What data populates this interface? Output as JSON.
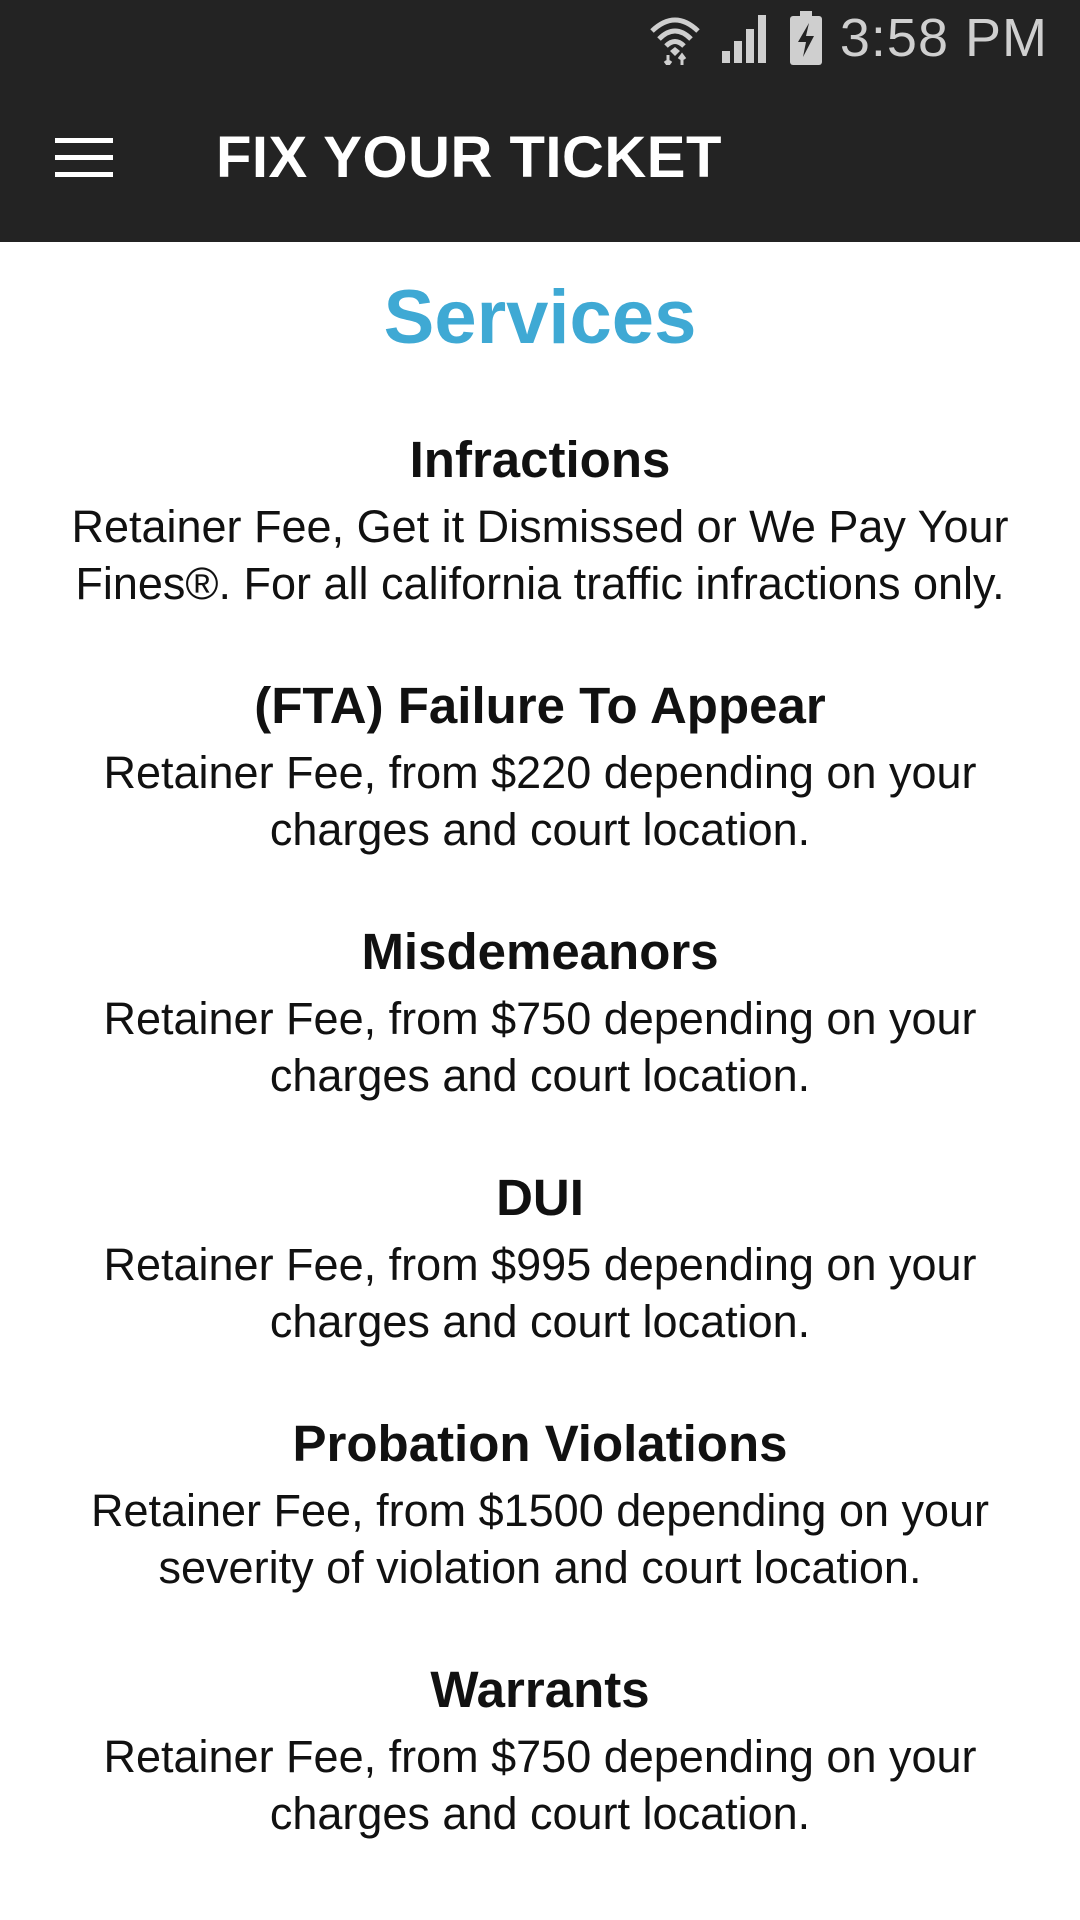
{
  "status_bar": {
    "time": "3:58 PM",
    "icons": [
      "wifi-icon",
      "signal-icon",
      "battery-charging-icon"
    ]
  },
  "app_bar": {
    "title": "FIX YOUR TICKET",
    "menu_icon": "hamburger-menu-icon"
  },
  "main": {
    "heading": "Services",
    "heading_color": "#3fa9d4",
    "services": [
      {
        "title": "Infractions",
        "description": "Retainer Fee, Get it Dismissed or We Pay Your Fines®. For all california traffic infractions only."
      },
      {
        "title": "(FTA) Failure To Appear",
        "description": "Retainer Fee, from $220 depending on your charges and court location."
      },
      {
        "title": "Misdemeanors",
        "description": "Retainer Fee, from $750 depending on your charges and court location."
      },
      {
        "title": "DUI",
        "description": "Retainer Fee, from $995 depending on your charges and court location."
      },
      {
        "title": "Probation Violations",
        "description": "Retainer Fee, from $1500 depending on your severity of violation and court location."
      },
      {
        "title": "Warrants",
        "description": "Retainer Fee, from $750 depending on your charges and court location."
      }
    ]
  }
}
